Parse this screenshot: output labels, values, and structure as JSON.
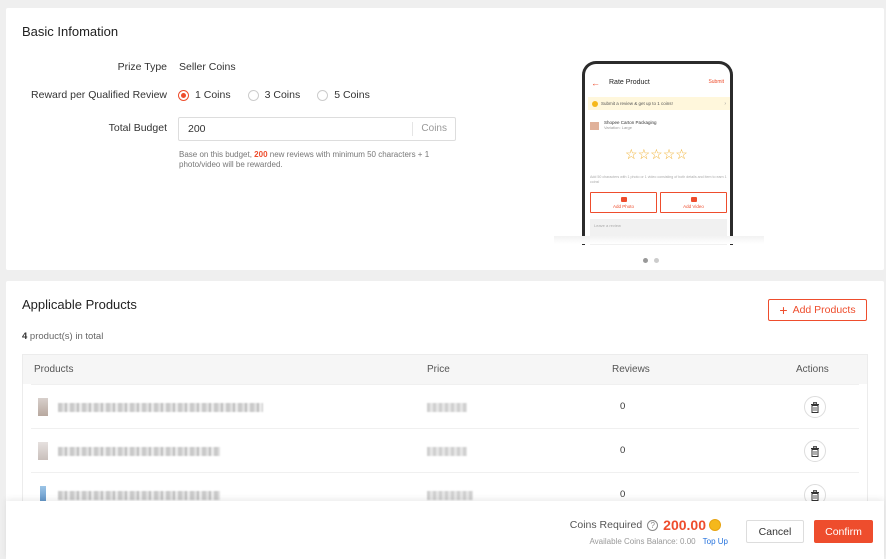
{
  "basic": {
    "title": "Basic Infomation",
    "prize_type_label": "Prize Type",
    "prize_type_value": "Seller Coins",
    "reward_label": "Reward per Qualified Review",
    "reward_options": [
      "1 Coins",
      "3 Coins",
      "5 Coins"
    ],
    "reward_selected": "1 Coins",
    "budget_label": "Total Budget",
    "budget_value": "200",
    "budget_suffix": "Coins",
    "hint_pre": "Base on this budget, ",
    "hint_count": "200",
    "hint_post": " new reviews with minimum 50 characters + 1 photo/video will be rewarded."
  },
  "preview": {
    "back_icon": "arrow-left-icon",
    "title": "Rate Product",
    "submit": "Submit",
    "banner": "Submit a review & get up to 1 coins!",
    "product_name": "Shopee Carton Packaging",
    "product_variation": "Variation: Large",
    "stars": 5,
    "note": "Add 50 characters with 1 photo or 1 video consisting of both details and item to earn 1 coins!",
    "add_photo": "Add Photo",
    "add_video": "Add Video",
    "textarea_placeholder": "Leave a review",
    "carousel_total": 2,
    "carousel_active": 1
  },
  "products": {
    "title": "Applicable Products",
    "add_button": "Add Products",
    "count": "4",
    "count_suffix": " product(s) in total",
    "columns": [
      "Products",
      "Price",
      "Reviews",
      "Actions"
    ],
    "rows": [
      {
        "reviews": "0"
      },
      {
        "reviews": "0"
      },
      {
        "reviews": "0"
      }
    ]
  },
  "footer": {
    "coins_required_label": "Coins Required",
    "coins_required_value": "200.00",
    "balance_label": "Available Coins Balance: 0.00",
    "top_up": "Top Up",
    "cancel": "Cancel",
    "confirm": "Confirm"
  },
  "colors": {
    "accent": "#ee4d2d",
    "link": "#2673dd",
    "coin": "#f5b81c"
  }
}
